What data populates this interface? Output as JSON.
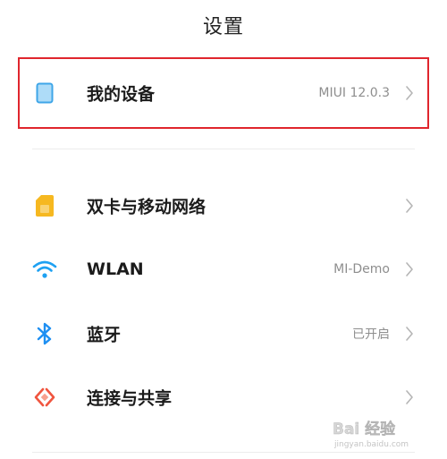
{
  "header": {
    "title": "设置"
  },
  "settings": {
    "my_device": {
      "label": "我的设备",
      "value": "MIUI 12.0.3",
      "icon": "tablet-icon",
      "icon_color": "#7cc6f5"
    },
    "items": [
      {
        "label": "双卡与移动网络",
        "value": "",
        "icon": "sim-card-icon",
        "icon_color": "#f6b820"
      },
      {
        "label": "WLAN",
        "value": "MI-Demo",
        "icon": "wifi-icon",
        "icon_color": "#1ea1f2"
      },
      {
        "label": "蓝牙",
        "value": "已开启",
        "icon": "bluetooth-icon",
        "icon_color": "#1e8ff2"
      },
      {
        "label": "连接与共享",
        "value": "",
        "icon": "connection-share-icon",
        "icon_color": "#f0553f"
      }
    ]
  },
  "colors": {
    "highlight_border": "#e0262d",
    "secondary_text": "#8e8e8e",
    "chevron": "#b5b5b5"
  },
  "watermark": {
    "text": "Bai 经验",
    "subtext": "jingyan.baidu.com"
  }
}
